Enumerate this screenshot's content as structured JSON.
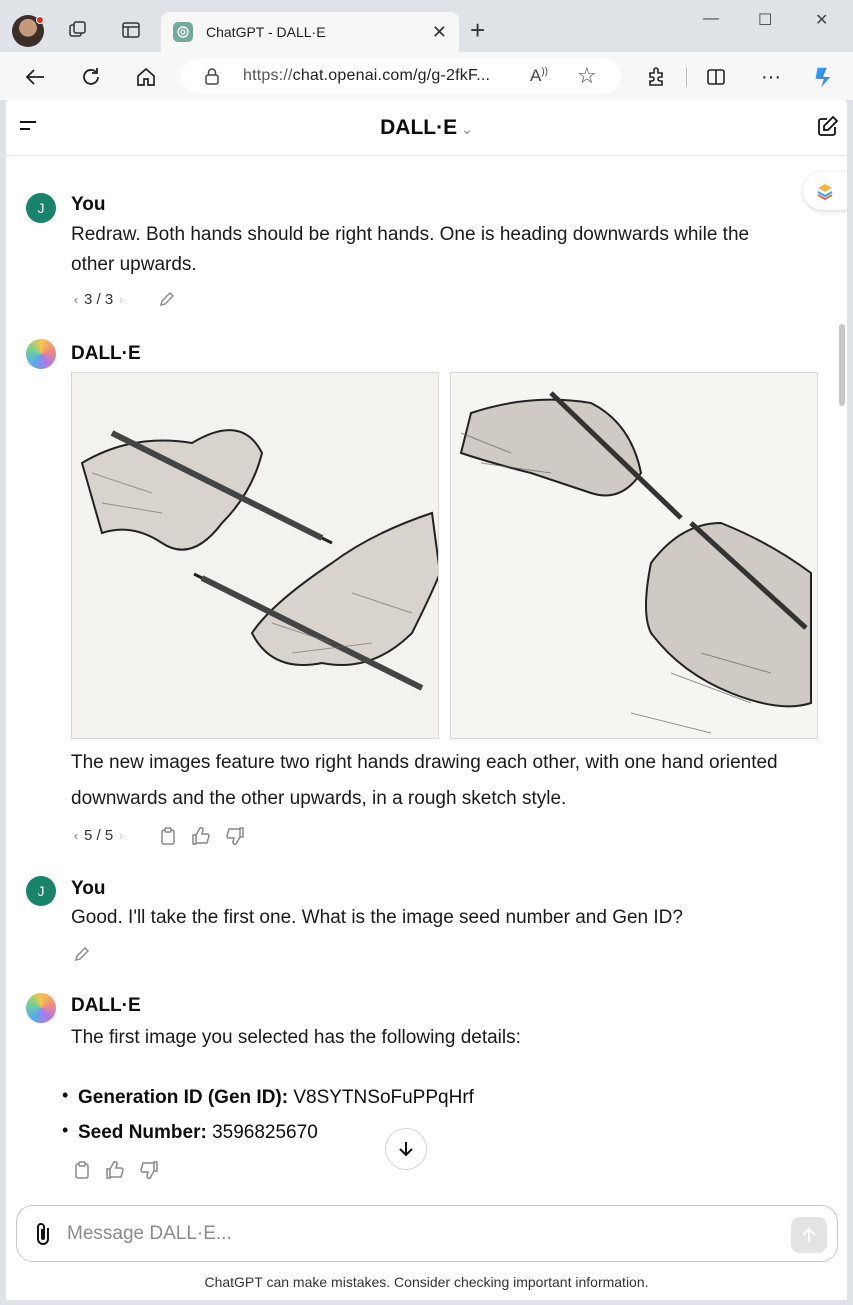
{
  "browser": {
    "tab_title": "ChatGPT - DALL·E",
    "url_prefix": "https://",
    "url_main": "chat.openai.com/g/g-2fkF..."
  },
  "header": {
    "title": "DALL·E"
  },
  "messages": [
    {
      "author": "You",
      "avatar_letter": "J",
      "text_line1": "Redraw. Both hands should be right hands. One is heading downwards while the",
      "text_line2": "other upwards.",
      "pager": "3 / 3"
    },
    {
      "author": "DALL·E",
      "text_line1": "The new images feature two right hands drawing each other, with one hand oriented",
      "text_line2": "downwards and the other upwards, in a rough sketch style.",
      "pager": "5 / 5"
    },
    {
      "author": "You",
      "avatar_letter": "J",
      "text_line1": "Good. I'll take the first one. What is the image seed number and Gen ID?"
    },
    {
      "author": "DALL·E",
      "text_line1": "The first image you selected has the following details:",
      "bullets": [
        {
          "key": "Generation ID (Gen ID):",
          "value": "V8SYTNSoFuPPqHrf"
        },
        {
          "key": "Seed Number:",
          "value": "3596825670"
        }
      ]
    }
  ],
  "composer": {
    "placeholder": "Message DALL·E..."
  },
  "disclaimer": "ChatGPT can make mistakes. Consider checking important information."
}
